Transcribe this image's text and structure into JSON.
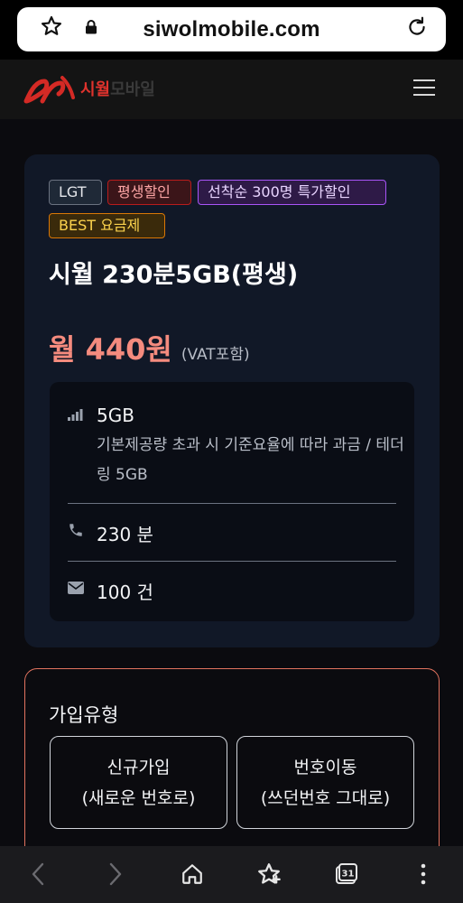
{
  "browser": {
    "url": "siwolmobile.com",
    "icons": [
      "star-outline-icon",
      "lock-icon",
      "reload-icon"
    ]
  },
  "site": {
    "logo_text_red": "시월",
    "logo_text_dark": "모바일"
  },
  "plan": {
    "tags": [
      "LGT",
      "평생할인",
      "선착순 300명 특가할인",
      "BEST 요금제"
    ],
    "name": "시월 230분5GB(평생)",
    "price": "월 440원",
    "vat_note": "(VAT포함)",
    "data": {
      "amount": "5GB",
      "note": "기본제공량 초과 시 기준요율에 따라 과금 / 테더링 5GB"
    },
    "voice": "230 분",
    "sms": "100 건"
  },
  "join": {
    "title": "가입유형",
    "options": [
      {
        "line1": "신규가입",
        "line2": "(새로운 번호로)"
      },
      {
        "line1": "번호이동",
        "line2": "(쓰던번호 그대로)"
      }
    ]
  },
  "bottom_nav": {
    "icons": [
      "back-icon",
      "forward-icon",
      "home-icon",
      "bookmark-star-icon",
      "calendar-tabs-icon",
      "more-icon"
    ],
    "tabs_count": "31"
  },
  "colors": {
    "accent_price": "#f58b7e",
    "brand_red": "#e0332d",
    "join_border": "#e2735f"
  }
}
